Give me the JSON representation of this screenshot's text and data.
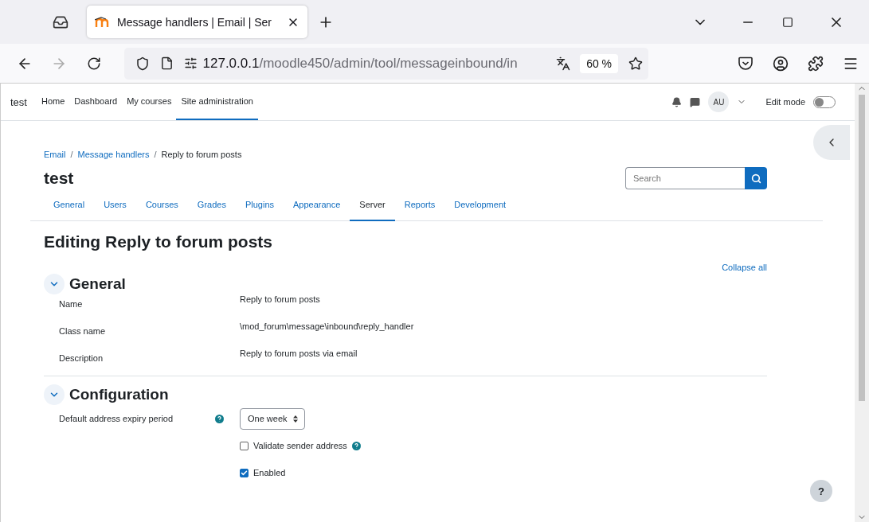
{
  "browser": {
    "tab_title": "Message handlers | Email | Ser",
    "url_host": "127.0.0.1",
    "url_path": "/moodle450/admin/tool/messageinbound/in",
    "zoom": "60 %"
  },
  "navbar": {
    "brand": "test",
    "items": [
      {
        "label": "Home",
        "selected": false
      },
      {
        "label": "Dashboard",
        "selected": false
      },
      {
        "label": "My courses",
        "selected": false
      },
      {
        "label": "Site administration",
        "selected": true
      }
    ],
    "avatar": "AU",
    "edit_mode": {
      "label": "Edit mode",
      "on": false
    }
  },
  "breadcrumb": [
    {
      "label": "Email",
      "link": true
    },
    {
      "separator": "/",
      "label": "Message handlers",
      "link": true
    },
    {
      "separator": "/",
      "label": "Reply to forum posts",
      "link": false
    }
  ],
  "page_title": "test",
  "search": {
    "placeholder": "Search"
  },
  "admin_tabs": [
    {
      "label": "General",
      "selected": false
    },
    {
      "label": "Users",
      "selected": false
    },
    {
      "label": "Courses",
      "selected": false
    },
    {
      "label": "Grades",
      "selected": false
    },
    {
      "label": "Plugins",
      "selected": false
    },
    {
      "label": "Appearance",
      "selected": false
    },
    {
      "label": "Server",
      "selected": true
    },
    {
      "label": "Reports",
      "selected": false
    },
    {
      "label": "Development",
      "selected": false
    }
  ],
  "heading": "Editing Reply to forum posts",
  "collapse_all": "Collapse all",
  "sections": [
    {
      "title": "General",
      "expanded": true,
      "rows": [
        {
          "kind": "static",
          "label": "Name",
          "value": "Reply to forum posts"
        },
        {
          "kind": "static",
          "label": "Class name",
          "value": "\\mod_forum\\message\\inbound\\reply_handler"
        },
        {
          "kind": "static",
          "label": "Description",
          "value": "Reply to forum posts via email"
        }
      ]
    },
    {
      "title": "Configuration",
      "expanded": true,
      "rows": [
        {
          "kind": "select",
          "label": "Default address expiry period",
          "help": true,
          "value": "One week"
        },
        {
          "kind": "checkbox",
          "label": "Validate sender address",
          "help": true,
          "checked": false
        },
        {
          "kind": "checkbox",
          "label": "Enabled",
          "help": false,
          "checked": true
        }
      ]
    }
  ],
  "help_button": "?"
}
